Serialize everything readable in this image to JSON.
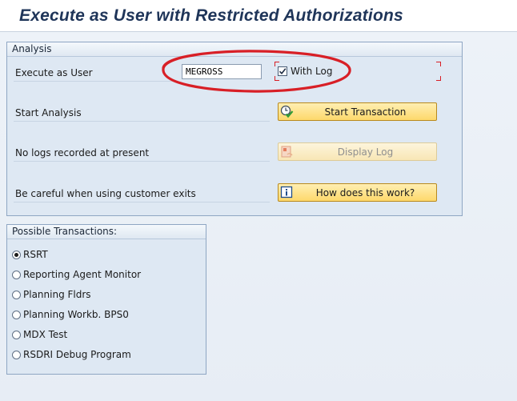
{
  "title": "Execute as User with Restricted Authorizations",
  "analysis": {
    "header": "Analysis",
    "execute_as_user_label": "Execute as User",
    "user_value": "MEGROSS",
    "with_log_label": "With Log",
    "with_log_checked": true,
    "rows": [
      {
        "label": "Start Analysis",
        "button": "Start Transaction",
        "icon": "clock-check-icon",
        "enabled": true
      },
      {
        "label": "No logs recorded at present",
        "button": "Display Log",
        "icon": "log-icon",
        "enabled": false
      },
      {
        "label": "Be careful when using customer exits",
        "button": "How does this work?",
        "icon": "info-icon",
        "enabled": true
      }
    ]
  },
  "possible": {
    "header": "Possible Transactions:",
    "options": [
      "RSRT",
      "Reporting Agent Monitor",
      "Planning Fldrs",
      "Planning Workb. BPS0",
      "MDX Test",
      "RSDRI Debug Program"
    ],
    "selected": "RSRT"
  },
  "colors": {
    "title": "#1f3559",
    "group_border": "#8ea6c3",
    "button_yellow": "#fdd86b",
    "annotation_red": "#d81f26"
  }
}
